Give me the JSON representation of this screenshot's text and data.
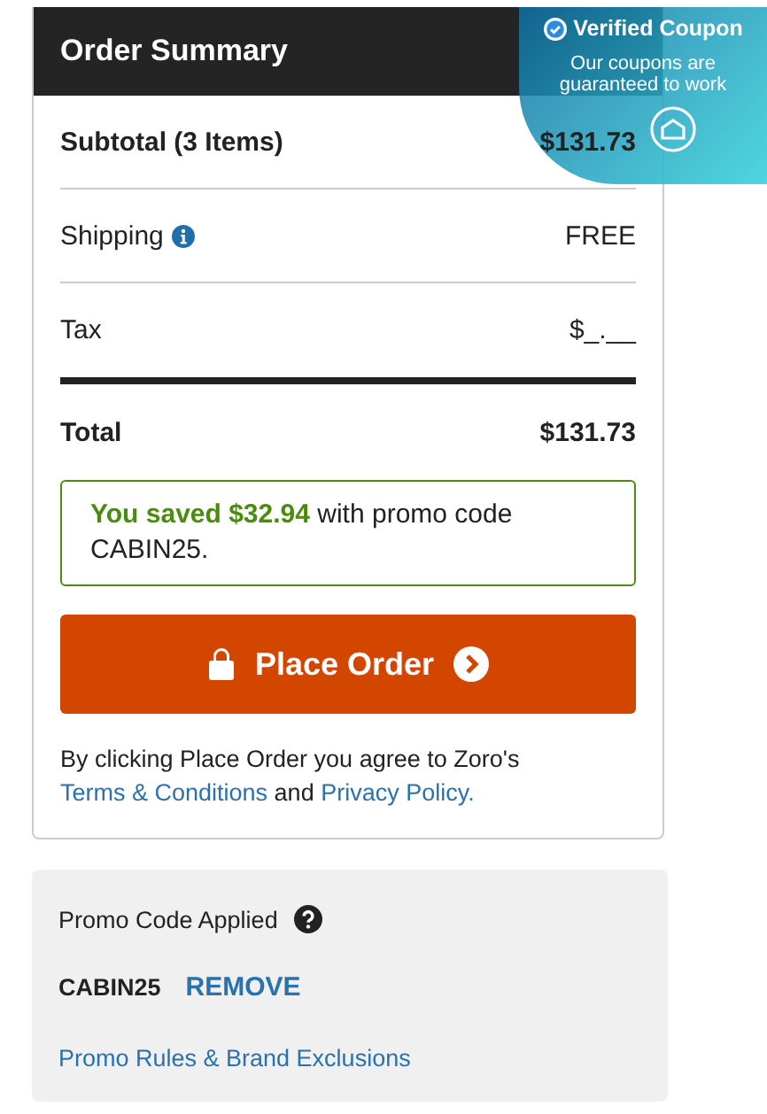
{
  "order_summary": {
    "title": "Order Summary",
    "rows": [
      {
        "kind": "subtotal",
        "label": "Subtotal (3 Items)",
        "value": "$131.73"
      },
      {
        "kind": "info",
        "label": "Shipping",
        "value": "FREE"
      },
      {
        "kind": "plain",
        "label": "Tax",
        "value": "$_.__"
      },
      {
        "kind": "total",
        "label": "Total",
        "value": "$131.73"
      }
    ],
    "savings_message": "**You saved $32.94** with promo code CABIN25.",
    "place_order_button": "Place Order",
    "agreement": {
      "text": "By clicking Place Order you agree to Zoro's",
      "terms_link": "Terms & Conditions",
      "joiner": "and",
      "privacy_link": "Privacy Policy."
    }
  },
  "verified_badge": {
    "title": "Verified Coupon",
    "subtitle": "Our coupons are guaranteed to work"
  },
  "promo_panel": {
    "title": "Promo Code Applied",
    "code": "CABIN25",
    "remove_link": "REMOVE",
    "rules_link": "Promo Rules & Brand Exclusions"
  }
}
